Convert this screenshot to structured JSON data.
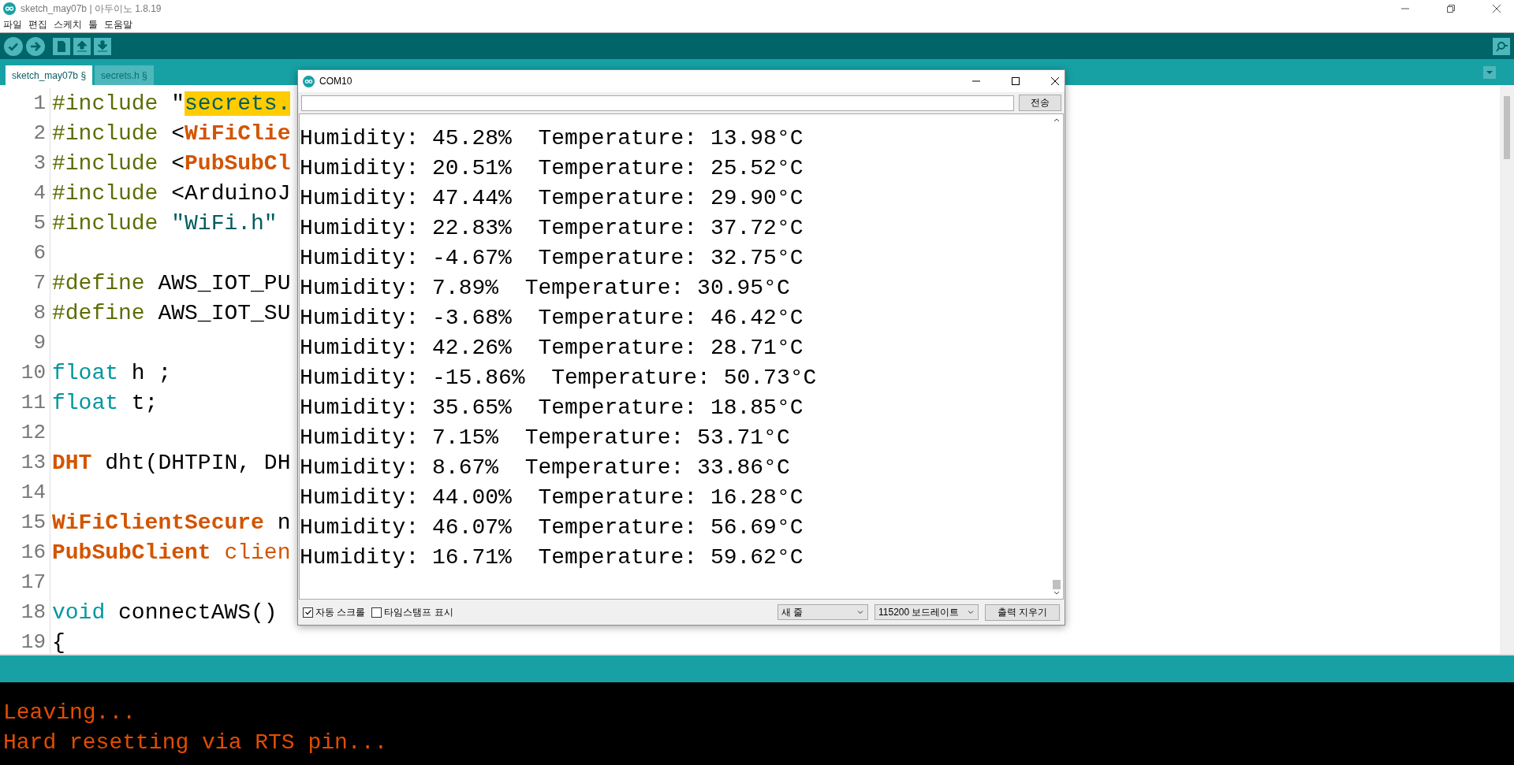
{
  "window": {
    "title": "sketch_may07b | 아두이노 1.8.19"
  },
  "menu": [
    "파일",
    "편집",
    "스케치",
    "툴",
    "도움말"
  ],
  "tabs": [
    {
      "label": "sketch_may07b §",
      "selected": true
    },
    {
      "label": "secrets.h §",
      "selected": false
    }
  ],
  "code_lines": [
    {
      "number": "1",
      "segments": [
        {
          "text": "#include",
          "kind": "directive"
        },
        {
          "text": " \"",
          "kind": "plain"
        },
        {
          "text": "secrets.",
          "kind": "highlight"
        }
      ]
    },
    {
      "number": "2",
      "segments": [
        {
          "text": "#include",
          "kind": "directive"
        },
        {
          "text": " <",
          "kind": "plain"
        },
        {
          "text": "WiFiClie",
          "kind": "class"
        }
      ]
    },
    {
      "number": "3",
      "segments": [
        {
          "text": "#include",
          "kind": "directive"
        },
        {
          "text": " <",
          "kind": "plain"
        },
        {
          "text": "PubSubCl",
          "kind": "class"
        }
      ]
    },
    {
      "number": "4",
      "segments": [
        {
          "text": "#include",
          "kind": "directive"
        },
        {
          "text": " <ArduinoJ",
          "kind": "plain"
        }
      ]
    },
    {
      "number": "5",
      "segments": [
        {
          "text": "#include",
          "kind": "directive"
        },
        {
          "text": " \"WiFi.h\"",
          "kind": "string"
        }
      ]
    },
    {
      "number": "6"
    },
    {
      "number": "7",
      "segments": [
        {
          "text": "#define",
          "kind": "directive"
        },
        {
          "text": " AWS_IOT_PU",
          "kind": "plain"
        }
      ]
    },
    {
      "number": "8",
      "segments": [
        {
          "text": "#define",
          "kind": "directive"
        },
        {
          "text": " AWS_IOT_SU",
          "kind": "plain"
        }
      ]
    },
    {
      "number": "9"
    },
    {
      "number": "10",
      "segments": [
        {
          "text": "float",
          "kind": "type"
        },
        {
          "text": " h ;",
          "kind": "plain"
        }
      ]
    },
    {
      "number": "11",
      "segments": [
        {
          "text": "float",
          "kind": "type"
        },
        {
          "text": " t;",
          "kind": "plain"
        }
      ]
    },
    {
      "number": "12"
    },
    {
      "number": "13",
      "segments": [
        {
          "text": "DHT",
          "kind": "class"
        },
        {
          "text": " dht(DHTPIN, DH",
          "kind": "plain"
        }
      ]
    },
    {
      "number": "14"
    },
    {
      "number": "15",
      "segments": [
        {
          "text": "WiFiClientSecure",
          "kind": "class"
        },
        {
          "text": " n",
          "kind": "plain"
        }
      ]
    },
    {
      "number": "16",
      "segments": [
        {
          "text": "PubSubClient",
          "kind": "class"
        },
        {
          "text": " clien",
          "kind": "name"
        }
      ]
    },
    {
      "number": "17"
    },
    {
      "number": "18",
      "segments": [
        {
          "text": "void",
          "kind": "type"
        },
        {
          "text": " connectAWS()",
          "kind": "plain"
        }
      ]
    },
    {
      "number": "19",
      "segments": [
        {
          "text": "{",
          "kind": "plain"
        }
      ]
    }
  ],
  "serial_monitor": {
    "title": "COM10",
    "send_button": "전송",
    "lines": [
      "Humidity: 45.28%  Temperature: 13.98°C",
      "Humidity: 20.51%  Temperature: 25.52°C",
      "Humidity: 47.44%  Temperature: 29.90°C",
      "Humidity: 22.83%  Temperature: 37.72°C",
      "Humidity: -4.67%  Temperature: 32.75°C",
      "Humidity: 7.89%  Temperature: 30.95°C",
      "Humidity: -3.68%  Temperature: 46.42°C",
      "Humidity: 42.26%  Temperature: 28.71°C",
      "Humidity: -15.86%  Temperature: 50.73°C",
      "Humidity: 35.65%  Temperature: 18.85°C",
      "Humidity: 7.15%  Temperature: 53.71°C",
      "Humidity: 8.67%  Temperature: 33.86°C",
      "Humidity: 44.00%  Temperature: 16.28°C",
      "Humidity: 46.07%  Temperature: 56.69°C",
      "Humidity: 16.71%  Temperature: 59.62°C"
    ],
    "autoscroll": {
      "label": "자동 스크롤",
      "checked": true
    },
    "timestamp": {
      "label": "타임스탬프 표시",
      "checked": false
    },
    "line_ending": "새 줄",
    "baud_rate": "115200 보드레이트",
    "clear_button": "출력 지우기"
  },
  "console": [
    "Leaving...",
    "Hard resetting via RTS pin..."
  ]
}
